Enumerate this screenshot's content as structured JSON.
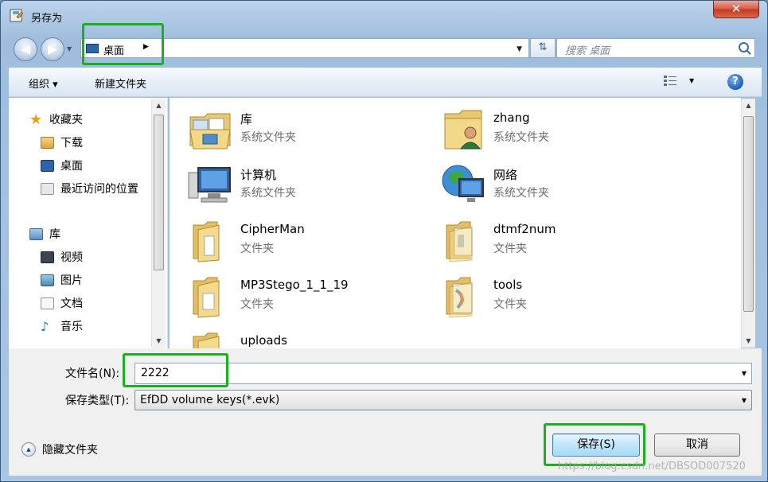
{
  "window": {
    "title": "另存为",
    "close_label": "✕"
  },
  "address": {
    "location": "桌面",
    "search_placeholder": "搜索 桌面"
  },
  "toolbar": {
    "organize": "组织 ▾",
    "new_folder": "新建文件夹"
  },
  "nav": {
    "favorites_header": "收藏夹",
    "favorites": [
      "下载",
      "桌面",
      "最近访问的位置"
    ],
    "libraries_header": "库",
    "libraries": [
      "视频",
      "图片",
      "文档",
      "音乐"
    ]
  },
  "files": [
    {
      "name": "库",
      "type": "系统文件夹",
      "icon": "library-icon"
    },
    {
      "name": "zhang",
      "type": "系统文件夹",
      "icon": "user-folder-icon"
    },
    {
      "name": "计算机",
      "type": "系统文件夹",
      "icon": "computer-icon"
    },
    {
      "name": "网络",
      "type": "系统文件夹",
      "icon": "network-icon"
    },
    {
      "name": "CipherMan",
      "type": "文件夹",
      "icon": "folder-icon"
    },
    {
      "name": "dtmf2num",
      "type": "文件夹",
      "icon": "folder-icon"
    },
    {
      "name": "MP3Stego_1_1_19",
      "type": "文件夹",
      "icon": "folder-icon"
    },
    {
      "name": "tools",
      "type": "文件夹",
      "icon": "folder-icon"
    },
    {
      "name": "uploads",
      "type": "",
      "icon": "folder-icon"
    }
  ],
  "form": {
    "filename_label": "文件名(N):",
    "filename_value": "2222",
    "type_label": "保存类型(T):",
    "type_value": "EfDD volume keys(*.evk)"
  },
  "buttons": {
    "hide_folders": "隐藏文件夹",
    "save": "保存(S)",
    "cancel": "取消"
  },
  "watermark": "https://blog.csdn.net/DBSOD007520",
  "colors": {
    "highlight": "#19b21f",
    "accent": "#3c7fb1"
  }
}
